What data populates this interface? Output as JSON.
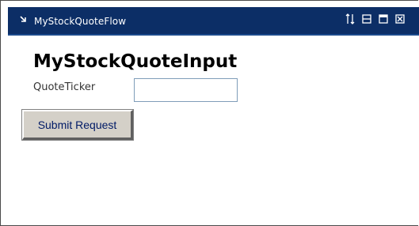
{
  "portlet": {
    "title": "MyStockQuoteFlow",
    "controls": [
      {
        "name": "move-icon",
        "glyph": "arrows-up-down"
      },
      {
        "name": "minimize-icon",
        "glyph": "minimize"
      },
      {
        "name": "maximize-icon",
        "glyph": "maximize"
      },
      {
        "name": "close-icon",
        "glyph": "close"
      }
    ],
    "colors": {
      "titlebar": "#0c2e66",
      "title_text": "#ffffff"
    }
  },
  "form": {
    "heading": "MyStockQuoteInput",
    "ticker_label": "QuoteTicker",
    "ticker_value": "",
    "submit_label": "Submit Request"
  }
}
